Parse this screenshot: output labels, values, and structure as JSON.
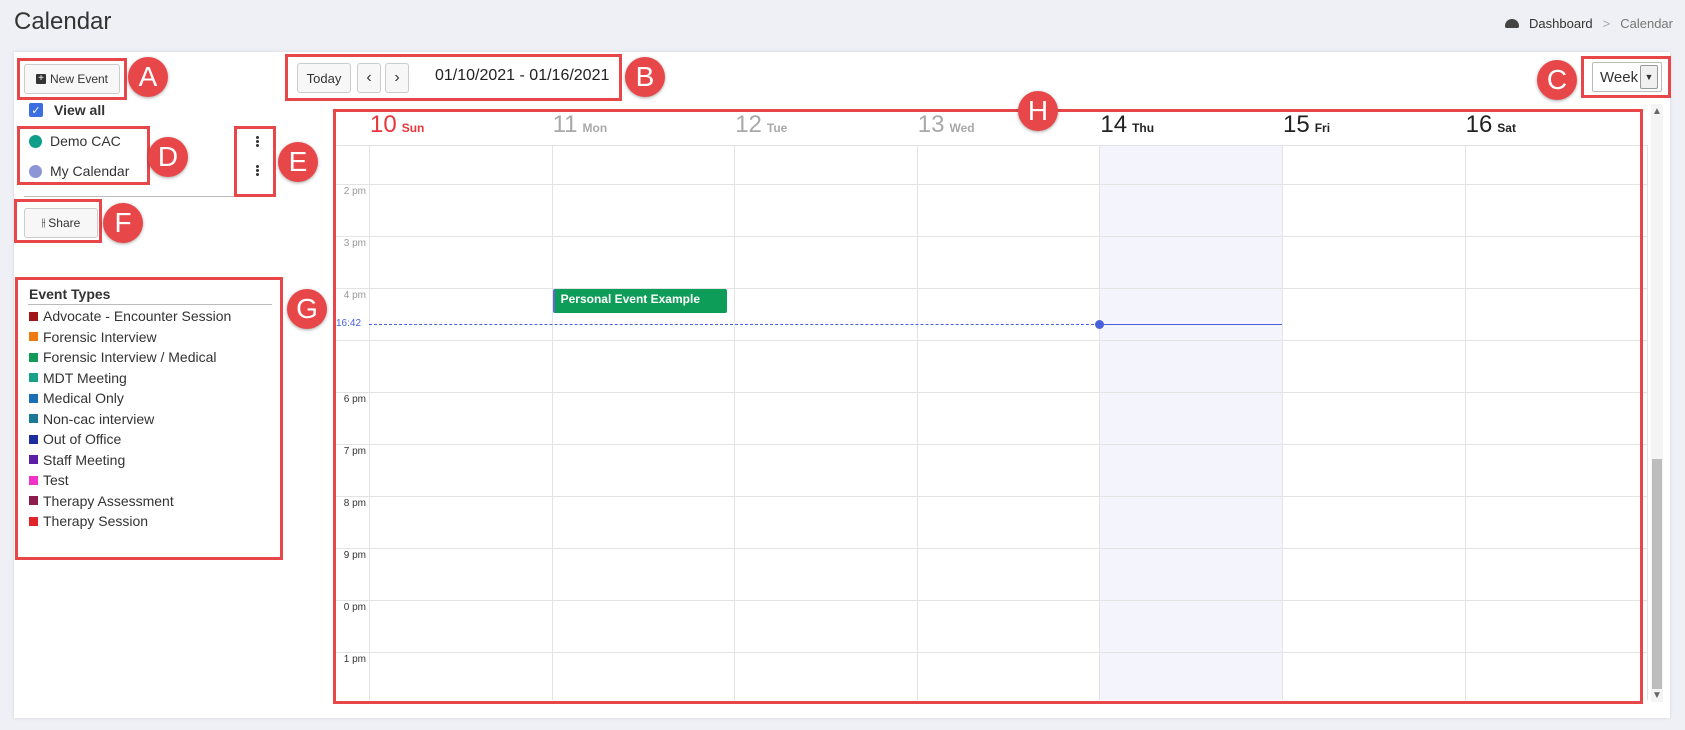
{
  "header": {
    "title": "Calendar",
    "breadcrumb": {
      "home": "Dashboard",
      "separator": ">",
      "current": "Calendar"
    }
  },
  "toolbar": {
    "new_event_label": "New Event",
    "today_label": "Today",
    "prev_symbol": "‹",
    "next_symbol": "›",
    "date_range": "01/10/2021 - 01/16/2021",
    "view_selected": "Week"
  },
  "sidebar": {
    "view_all_label": "View all",
    "calendars": [
      {
        "name": "Demo CAC",
        "color": "#0d9f89"
      },
      {
        "name": "My Calendar",
        "color": "#8c96d6"
      }
    ],
    "share_label": "Share",
    "event_types_title": "Event Types",
    "event_types": [
      {
        "label": "Advocate - Encounter Session",
        "color": "#a0161b"
      },
      {
        "label": "Forensic Interview",
        "color": "#f07a12"
      },
      {
        "label": "Forensic Interview / Medical",
        "color": "#129a58"
      },
      {
        "label": "MDT Meeting",
        "color": "#19a089"
      },
      {
        "label": "Medical Only",
        "color": "#1b6fb3"
      },
      {
        "label": "Non-cac interview",
        "color": "#1a7a96"
      },
      {
        "label": "Out of Office",
        "color": "#1c2d9e"
      },
      {
        "label": "Staff Meeting",
        "color": "#5a1fa6"
      },
      {
        "label": "Test",
        "color": "#f032c8"
      },
      {
        "label": "Therapy Assessment",
        "color": "#8c1c4c"
      },
      {
        "label": "Therapy Session",
        "color": "#e0242a"
      }
    ]
  },
  "week": {
    "days": [
      {
        "num": "10",
        "name": "Sun",
        "state": "sunday"
      },
      {
        "num": "11",
        "name": "Mon",
        "state": "past"
      },
      {
        "num": "12",
        "name": "Tue",
        "state": "past"
      },
      {
        "num": "13",
        "name": "Wed",
        "state": "past"
      },
      {
        "num": "14",
        "name": "Thu",
        "state": "today"
      },
      {
        "num": "15",
        "name": "Fri",
        "state": "future"
      },
      {
        "num": "16",
        "name": "Sat",
        "state": "future"
      }
    ],
    "time_labels": [
      "2 pm",
      "3 pm",
      "4 pm",
      "6 pm",
      "7 pm",
      "8 pm",
      "9 pm",
      "0 pm",
      "1 pm"
    ],
    "current_time": "16:42",
    "events": [
      {
        "title": "Personal Event Example",
        "day": "Mon",
        "start": "16:00",
        "color": "#0e9d58"
      }
    ]
  },
  "annotations": [
    "A",
    "B",
    "C",
    "D",
    "E",
    "F",
    "G",
    "H"
  ],
  "colors": {
    "sunday": "#e8363c",
    "past": "#a9a9a9",
    "current": "#222222",
    "today_bg": "#f3f4fc",
    "now_line": "#4a61dd",
    "annotation": "#e8474a"
  }
}
